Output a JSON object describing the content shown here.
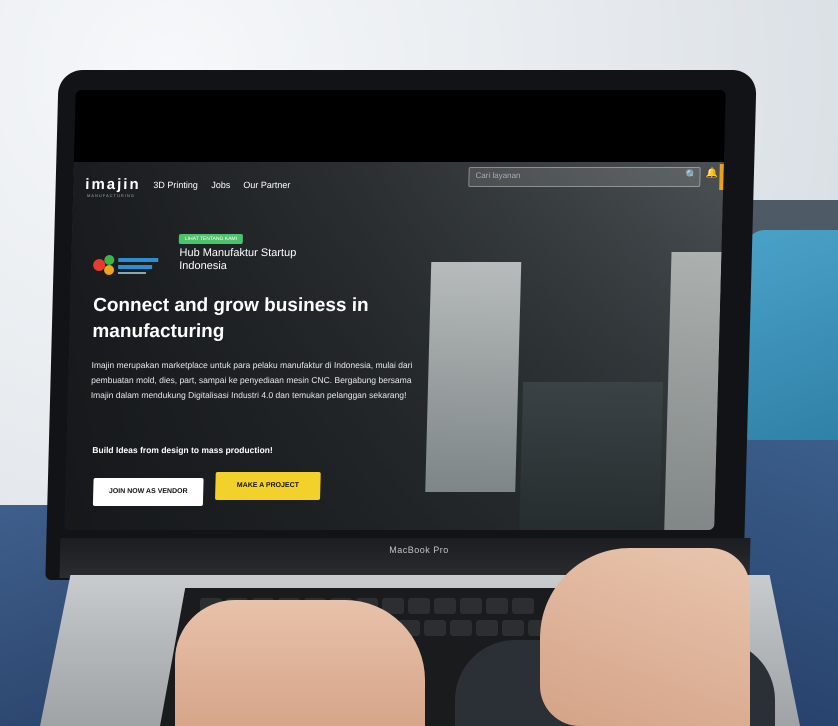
{
  "colors": {
    "accent_yellow": "#f3d12b",
    "badge_green": "#4cc26a",
    "text_white": "#ffffff"
  },
  "laptop": {
    "brand_label": "MacBook Pro"
  },
  "website": {
    "logo_text": "imajin",
    "logo_subtext": "MANUFACTURING",
    "nav_links": [
      "3D Printing",
      "Jobs",
      "Our Partner"
    ],
    "search": {
      "placeholder": "Cari layanan"
    },
    "icons": [
      "search-icon",
      "bell-icon"
    ],
    "partner": {
      "badge": "LIHAT TENTANG KAMI",
      "title": "Hub Manufaktur Startup Indonesia"
    },
    "headline": "Connect and grow business in manufacturing",
    "description": "Imajin merupakan marketplace untuk para pelaku manufaktur di Indonesia, mulai dari pembuatan mold, dies, part, sampai ke penyediaan mesin CNC. Bergabung bersama Imajin dalam mendukung Digitalisasi Industri 4.0 dan temukan pelanggan sekarang!",
    "tagline": "Build Ideas from design to mass production!",
    "buttons": {
      "vendor": "JOIN NOW AS VENDOR",
      "project": "MAKE A PROJECT"
    }
  }
}
